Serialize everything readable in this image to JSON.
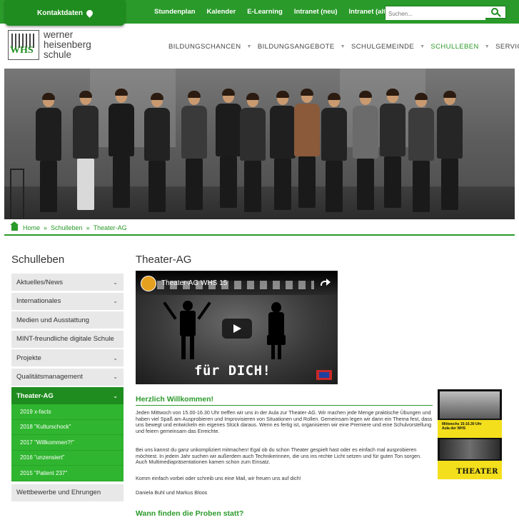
{
  "topbar": {
    "contact_label": "Kontaktdaten",
    "links": [
      "Stundenplan",
      "Kalender",
      "E-Learning",
      "Intranet (neu)",
      "Intranet (alt)"
    ],
    "search_placeholder": "Suchen..."
  },
  "logo": {
    "line1": "werner",
    "line2": "heisenberg",
    "line3": "schule",
    "mark": "WHS"
  },
  "mainnav": {
    "items": [
      "BILDUNGSCHANCEN",
      "BILDUNGSANGEBOTE",
      "SCHULGEMEINDE",
      "SCHULLEBEN",
      "SERVICE"
    ],
    "active": "SCHULLEBEN"
  },
  "breadcrumb": {
    "home": "Home",
    "level1": "Schulleben",
    "level2": "Theater-AG"
  },
  "sidebar": {
    "title": "Schulleben",
    "items": [
      "Aktuelles/News",
      "Internationales",
      "Medien und Ausstattung",
      "MINT-freundliche digitale Schule",
      "Projekte",
      "Qualitätsmanagement",
      "Theater-AG",
      "Wettbewerbe und Ehrungen"
    ],
    "subitems": [
      "2019 x-facts",
      "2018 \"Kulturschock\"",
      "2017 \"Willkommen?!\"",
      "2016 \"unzensiert\"",
      "2015 \"Patient 237\""
    ]
  },
  "main": {
    "title": "Theater-AG",
    "video": {
      "title": "Theater-AG WHS 15",
      "overlay_text": "für DICH!"
    },
    "welcome_heading": "Herzlich Willkommen!",
    "para1": "Jeden Mittwoch von 15.00-16.30 Uhr treffen wir uns in der Aula zur Theater-AG. Wir machen jede Menge praktische Übungen und haben viel Spaß am Ausprobieren und Improvisieren von Situationen und Rollen. Gemeinsam legen wir dann ein Thema fest, dass uns bewegt und entwickeln ein eigenes Stück daraus. Wenn es fertig ist, organisieren wir eine Premiere und eine Schulvorstellung und feiern gemeinsam das Erreichte.",
    "para2": "Bei uns kannst du ganz unkompliziert mitmachen! Egal ob du schon Theater gespielt hast oder es einfach mal ausprobieren möchtest. In jedem Jahr suchen wir außerdem auch Technikerinnen, die uns ins rechte Licht setzen und für guten Ton sorgen. Auch Multimediapräsentationen kamen schon zum Einsatz.",
    "para3": "Komm einfach vorbei oder schreib uns eine Mail, wir freuen uns auf dich!",
    "signature": "Daniela Buhl und Markus Bloos",
    "rehearsal_heading": "Wann finden die Proben statt?",
    "poster": {
      "line1": "Mittwochs 15-16.30 Uhr",
      "line2": "Aula der WHS",
      "label": "THEATER"
    }
  },
  "colors": {
    "brand_green": "#2a9a2a",
    "sub_green": "#2fb52f",
    "poster_yellow": "#f3df1c"
  }
}
